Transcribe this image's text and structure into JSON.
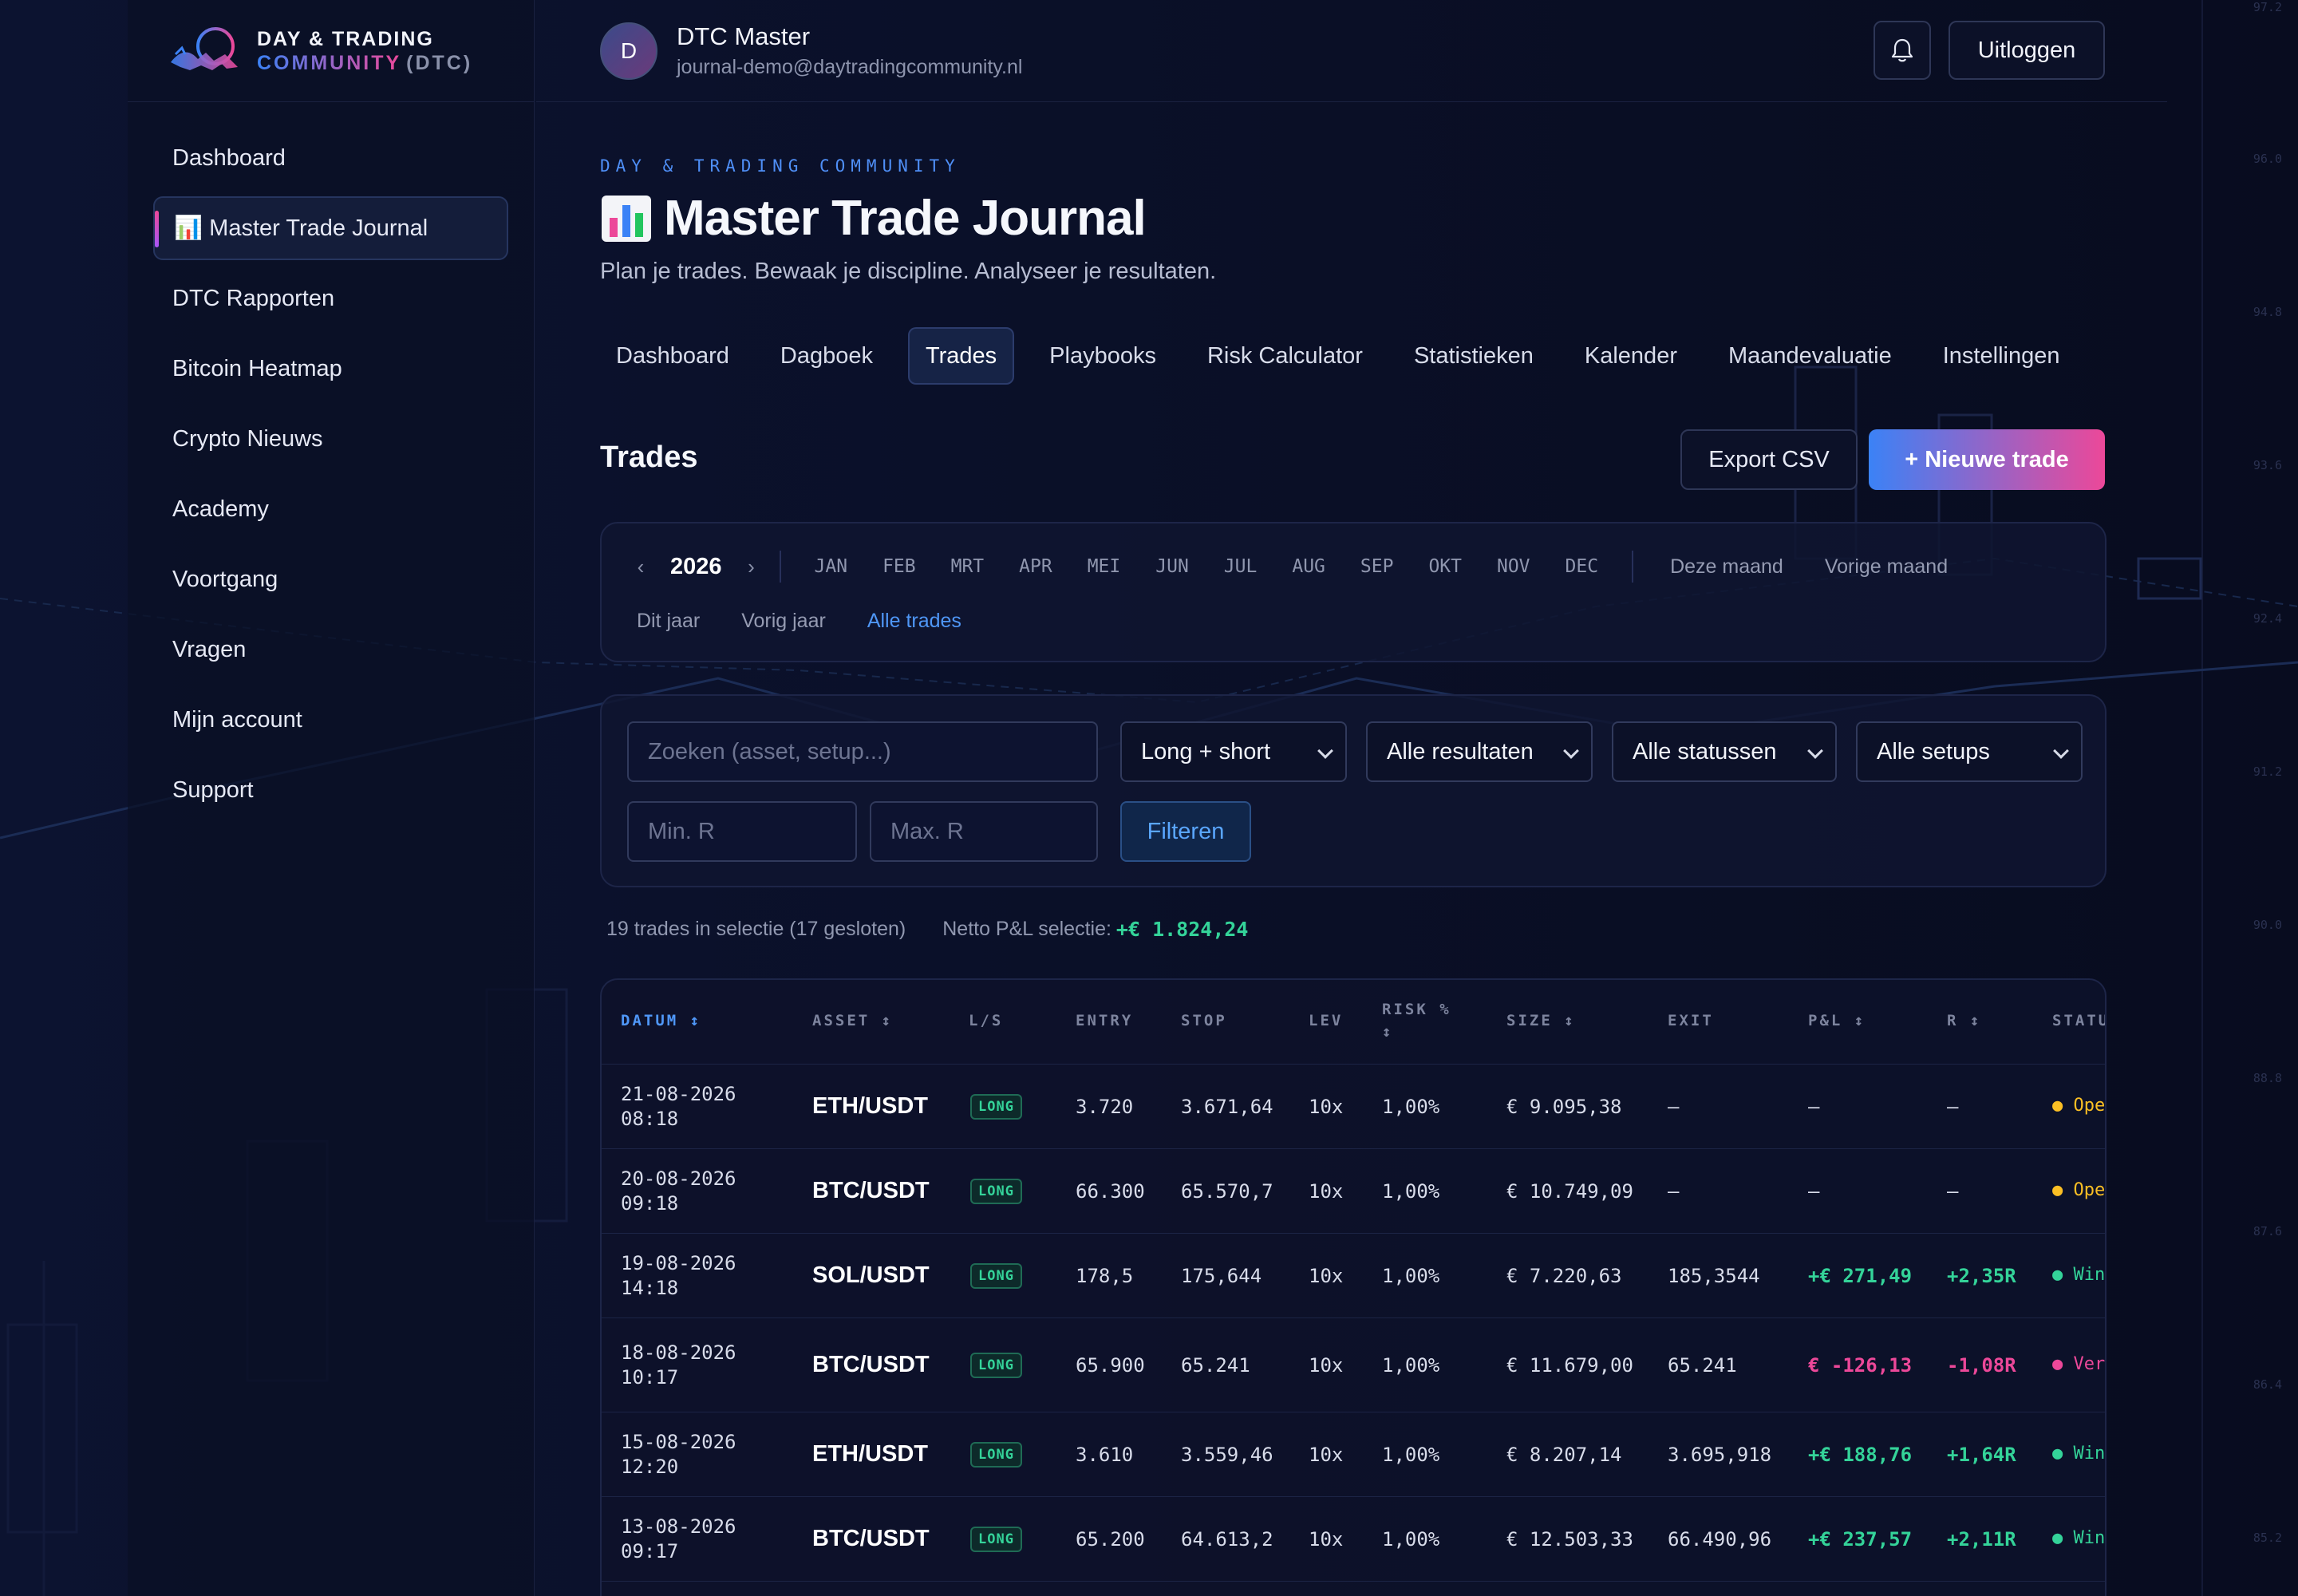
{
  "brand": {
    "line1": "DAY & TRADING",
    "community": "COMMUNITY",
    "dtc": "(DTC)"
  },
  "sidebar": {
    "items": [
      {
        "label": "Dashboard"
      },
      {
        "label": "📊 Master Trade Journal",
        "active": true
      },
      {
        "label": "DTC Rapporten"
      },
      {
        "label": "Bitcoin Heatmap"
      },
      {
        "label": "Crypto Nieuws"
      },
      {
        "label": "Academy"
      },
      {
        "label": "Voortgang"
      },
      {
        "label": "Vragen"
      },
      {
        "label": "Mijn account"
      },
      {
        "label": "Support"
      }
    ]
  },
  "user": {
    "initial": "D",
    "name": "DTC Master",
    "email": "journal-demo@daytradingcommunity.nl"
  },
  "header": {
    "logout": "Uitloggen"
  },
  "page": {
    "eyebrow": "DAY & TRADING COMMUNITY",
    "title": "Master Trade Journal",
    "subtitle": "Plan je trades. Bewaak je discipline. Analyseer je resultaten."
  },
  "tabs": [
    "Dashboard",
    "Dagboek",
    "Trades",
    "Playbooks",
    "Risk Calculator",
    "Statistieken",
    "Kalender",
    "Maandevaluatie",
    "Instellingen"
  ],
  "active_tab": "Trades",
  "section": {
    "title": "Trades",
    "export": "Export CSV",
    "new_trade": "+ Nieuwe trade"
  },
  "period": {
    "prev": "‹",
    "next": "›",
    "year": "2026",
    "months": [
      "JAN",
      "FEB",
      "MRT",
      "APR",
      "MEI",
      "JUN",
      "JUL",
      "AUG",
      "SEP",
      "OKT",
      "NOV",
      "DEC"
    ],
    "quick_row1": [
      "Deze maand",
      "Vorige maand"
    ],
    "quick_row2": [
      "Dit jaar",
      "Vorig jaar",
      "Alle trades"
    ],
    "active_quick": "Alle trades"
  },
  "filters": {
    "search_placeholder": "Zoeken (asset, setup...)",
    "direction": "Long + short",
    "results": "Alle resultaten",
    "statuses": "Alle statussen",
    "setups": "Alle setups",
    "min_r_placeholder": "Min. R",
    "max_r_placeholder": "Max. R",
    "apply": "Filteren"
  },
  "summary": {
    "count_text": "19 trades in selectie (17 gesloten)",
    "netto_label": "Netto P&L selectie:",
    "netto_value": "+€ 1.824,24"
  },
  "table": {
    "columns": [
      "DATUM ↕",
      "ASSET ↕",
      "L/S",
      "ENTRY",
      "STOP",
      "LEV",
      "RISK %",
      "↕",
      "SIZE ↕",
      "EXIT",
      "P&L ↕",
      "R ↕",
      "STATUS"
    ],
    "rows": [
      {
        "date": "21-08-2026",
        "time": "08:18",
        "asset": "ETH/USDT",
        "side": "LONG",
        "entry": "3.720",
        "stop": "3.671,64",
        "lev": "10x",
        "risk": "1,00%",
        "size": "€ 9.095,38",
        "exit": "—",
        "pnl": "—",
        "r": "—",
        "status": "● Open",
        "status_type": "open"
      },
      {
        "date": "20-08-2026",
        "time": "09:18",
        "asset": "BTC/USDT",
        "side": "LONG",
        "entry": "66.300",
        "stop": "65.570,7",
        "lev": "10x",
        "risk": "1,00%",
        "size": "€ 10.749,09",
        "exit": "—",
        "pnl": "—",
        "r": "—",
        "status": "● Open",
        "status_type": "open"
      },
      {
        "date": "19-08-2026",
        "time": "14:18",
        "asset": "SOL/USDT",
        "side": "LONG",
        "entry": "178,5",
        "stop": "175,644",
        "lev": "10x",
        "risk": "1,00%",
        "size": "€ 7.220,63",
        "exit": "185,3544",
        "pnl": "+€ 271,49",
        "r": "+2,35R",
        "status": "● Win",
        "status_type": "win"
      },
      {
        "date": "18-08-2026",
        "time": "10:17",
        "asset": "BTC/USDT",
        "side": "LONG",
        "entry": "65.900",
        "stop": "65.241",
        "lev": "10x",
        "risk": "1,00%",
        "size": "€ 11.679,00",
        "exit": "65.241",
        "pnl": "€ -126,13",
        "r": "-1,08R",
        "status": "● Verlies",
        "status_type": "loss"
      },
      {
        "date": "15-08-2026",
        "time": "12:20",
        "asset": "ETH/USDT",
        "side": "LONG",
        "entry": "3.610",
        "stop": "3.559,46",
        "lev": "10x",
        "risk": "1,00%",
        "size": "€ 8.207,14",
        "exit": "3.695,918",
        "pnl": "+€ 188,76",
        "r": "+1,64R",
        "status": "● Win",
        "status_type": "win"
      },
      {
        "date": "13-08-2026",
        "time": "09:17",
        "asset": "BTC/USDT",
        "side": "LONG",
        "entry": "65.200",
        "stop": "64.613,2",
        "lev": "10x",
        "risk": "1,00%",
        "size": "€ 12.503,33",
        "exit": "66.490,96",
        "pnl": "+€ 237,57",
        "r": "+2,11R",
        "status": "● Win",
        "status_type": "win"
      }
    ]
  },
  "colors": {
    "accent_blue": "#3b82f6",
    "accent_pink": "#ec4899",
    "positive": "#34d399",
    "negative": "#ec4899",
    "open": "#fbbf24"
  }
}
